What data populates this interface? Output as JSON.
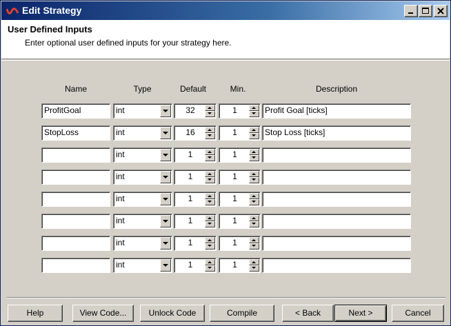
{
  "window": {
    "title": "Edit Strategy",
    "icon": "strategy-app-icon",
    "controls": {
      "minimize": "minimize-icon",
      "maximize": "maximize-icon",
      "close": "close-icon"
    }
  },
  "header": {
    "title": "User Defined Inputs",
    "subtitle": "Enter optional user defined inputs for your strategy here."
  },
  "columns": {
    "name": "Name",
    "type": "Type",
    "default": "Default",
    "min": "Min.",
    "description": "Description"
  },
  "rows": [
    {
      "name": "ProfitGoal",
      "type": "int",
      "default": "32",
      "min": "1",
      "description": "Profit Goal [ticks]"
    },
    {
      "name": "StopLoss",
      "type": "int",
      "default": "16",
      "min": "1",
      "description": "Stop Loss [ticks]"
    },
    {
      "name": "",
      "type": "int",
      "default": "1",
      "min": "1",
      "description": ""
    },
    {
      "name": "",
      "type": "int",
      "default": "1",
      "min": "1",
      "description": ""
    },
    {
      "name": "",
      "type": "int",
      "default": "1",
      "min": "1",
      "description": ""
    },
    {
      "name": "",
      "type": "int",
      "default": "1",
      "min": "1",
      "description": ""
    },
    {
      "name": "",
      "type": "int",
      "default": "1",
      "min": "1",
      "description": ""
    },
    {
      "name": "",
      "type": "int",
      "default": "1",
      "min": "1",
      "description": ""
    }
  ],
  "buttons": {
    "help": "Help",
    "view_code": "View Code...",
    "unlock_code": "Unlock Code",
    "compile": "Compile",
    "back": "< Back",
    "next": "Next >",
    "cancel": "Cancel"
  }
}
